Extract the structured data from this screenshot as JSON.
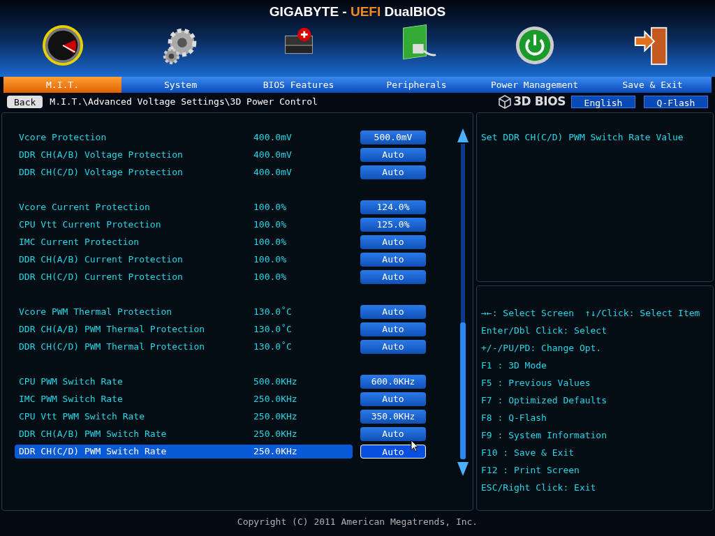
{
  "header": {
    "title_start": "GIGABYTE -",
    "title_highlight": "UEFI",
    "title_end": "DualBIOS"
  },
  "tabs": [
    {
      "label": "M.I.T.",
      "selected": true
    },
    {
      "label": "System",
      "selected": false
    },
    {
      "label": "BIOS Features",
      "selected": false
    },
    {
      "label": "Peripherals",
      "selected": false
    },
    {
      "label": "Power Management",
      "selected": false
    },
    {
      "label": "Save & Exit",
      "selected": false
    }
  ],
  "nav": {
    "back": "Back",
    "path": "M.I.T.\\Advanced Voltage Settings\\3D Power Control",
    "logo": "3D BIOS",
    "language": "English",
    "qflash": "Q-Flash"
  },
  "groups": [
    {
      "rows": [
        {
          "name": "Vcore Protection",
          "default": "400.0mV",
          "value": "500.0mV",
          "selected": false
        },
        {
          "name": "DDR CH(A/B) Voltage Protection",
          "default": "400.0mV",
          "value": "Auto",
          "selected": false
        },
        {
          "name": "DDR CH(C/D) Voltage Protection",
          "default": "400.0mV",
          "value": "Auto",
          "selected": false
        }
      ]
    },
    {
      "rows": [
        {
          "name": "Vcore Current Protection",
          "default": "100.0%",
          "value": "124.0%",
          "selected": false
        },
        {
          "name": "CPU Vtt Current Protection",
          "default": "100.0%",
          "value": "125.0%",
          "selected": false
        },
        {
          "name": "IMC Current Protection",
          "default": "100.0%",
          "value": "Auto",
          "selected": false
        },
        {
          "name": "DDR CH(A/B) Current Protection",
          "default": "100.0%",
          "value": "Auto",
          "selected": false
        },
        {
          "name": "DDR CH(C/D) Current Protection",
          "default": "100.0%",
          "value": "Auto",
          "selected": false
        }
      ]
    },
    {
      "rows": [
        {
          "name": "Vcore PWM Thermal Protection",
          "default": "130.0˚C",
          "value": "Auto",
          "selected": false
        },
        {
          "name": "DDR CH(A/B) PWM Thermal Protection",
          "default": "130.0˚C",
          "value": "Auto",
          "selected": false
        },
        {
          "name": "DDR CH(C/D) PWM Thermal Protection",
          "default": "130.0˚C",
          "value": "Auto",
          "selected": false
        }
      ]
    },
    {
      "rows": [
        {
          "name": "CPU PWM Switch Rate",
          "default": "500.0KHz",
          "value": "600.0KHz",
          "selected": false
        },
        {
          "name": "IMC PWM Switch Rate",
          "default": "250.0KHz",
          "value": "Auto",
          "selected": false
        },
        {
          "name": "CPU Vtt PWM Switch Rate",
          "default": "250.0KHz",
          "value": "350.0KHz",
          "selected": false
        },
        {
          "name": "DDR CH(A/B) PWM Switch Rate",
          "default": "250.0KHz",
          "value": "Auto",
          "selected": false
        },
        {
          "name": "DDR CH(C/D) PWM Switch Rate",
          "default": "250.0KHz",
          "value": "Auto",
          "selected": true
        }
      ]
    }
  ],
  "help": "Set DDR CH(C/D) PWM Switch Rate Value",
  "keys": [
    [
      "→←: Select Screen",
      "↑↓/Click: Select Item"
    ],
    [
      "Enter/Dbl Click: Select"
    ],
    [
      "+/-/PU/PD: Change Opt."
    ],
    [
      "F1  : 3D Mode"
    ],
    [
      "F5  : Previous Values"
    ],
    [
      "F7  : Optimized Defaults"
    ],
    [
      "F8  : Q-Flash"
    ],
    [
      "F9  : System Information"
    ],
    [
      "F10 : Save & Exit"
    ],
    [
      "F12 : Print Screen"
    ],
    [
      "ESC/Right Click: Exit"
    ]
  ],
  "copyright": "Copyright (C) 2011 American Megatrends, Inc."
}
